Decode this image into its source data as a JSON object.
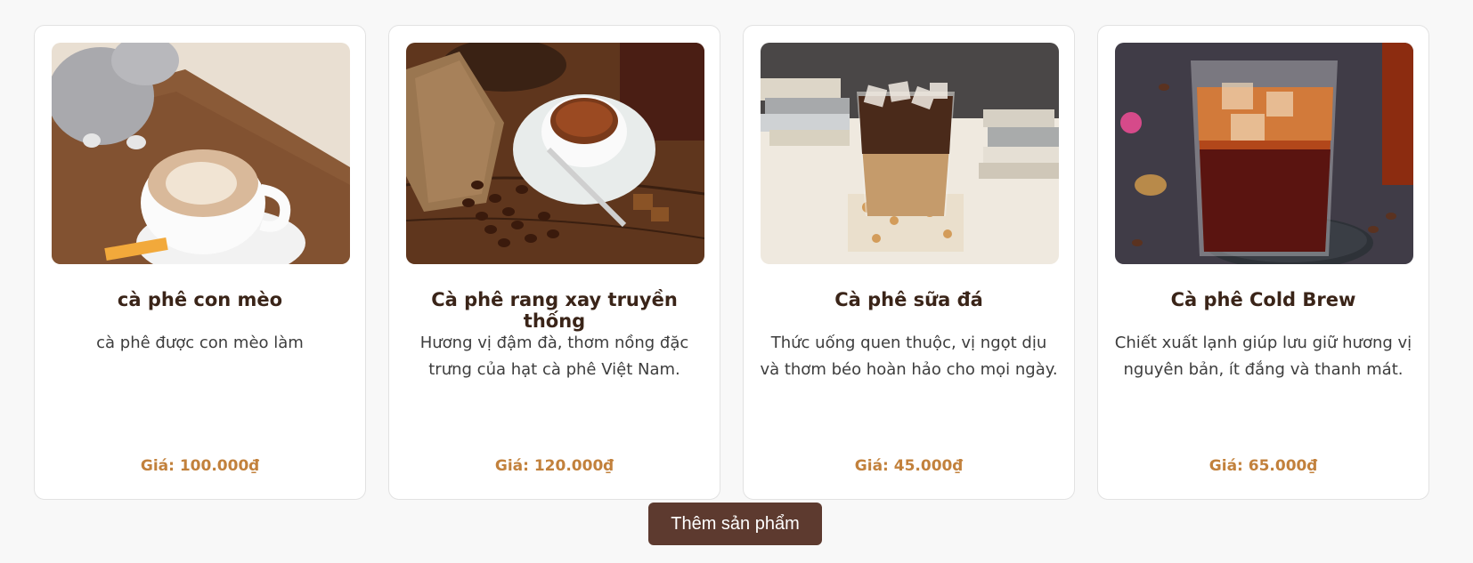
{
  "products": [
    {
      "name": "cà phê con mèo",
      "description": "cà phê được con mèo làm",
      "price": "Giá: 100.000₫",
      "image": "cat-latte-photo"
    },
    {
      "name": "Cà phê rang xay truyền thống",
      "description": "Hương vị đậm đà, thơm nồng đặc trưng của hạt cà phê Việt Nam.",
      "price": "Giá: 120.000₫",
      "image": "coffee-beans-cup-photo"
    },
    {
      "name": "Cà phê sữa đá",
      "description": "Thức uống quen thuộc, vị ngọt dịu và thơm béo hoàn hảo cho mọi ngày.",
      "price": "Giá: 45.000₫",
      "image": "iced-milk-coffee-photo"
    },
    {
      "name": "Cà phê Cold Brew",
      "description": "Chiết xuất lạnh giúp lưu giữ hương vị nguyên bản, ít đắng và thanh mát.",
      "price": "Giá: 65.000₫",
      "image": "cold-brew-glass-photo"
    }
  ],
  "actions": {
    "add_product_label": "Thêm sản phẩm"
  },
  "colors": {
    "accent_price": "#c2813c",
    "button_bg": "#5d3a2f",
    "title_text": "#3a2418"
  }
}
